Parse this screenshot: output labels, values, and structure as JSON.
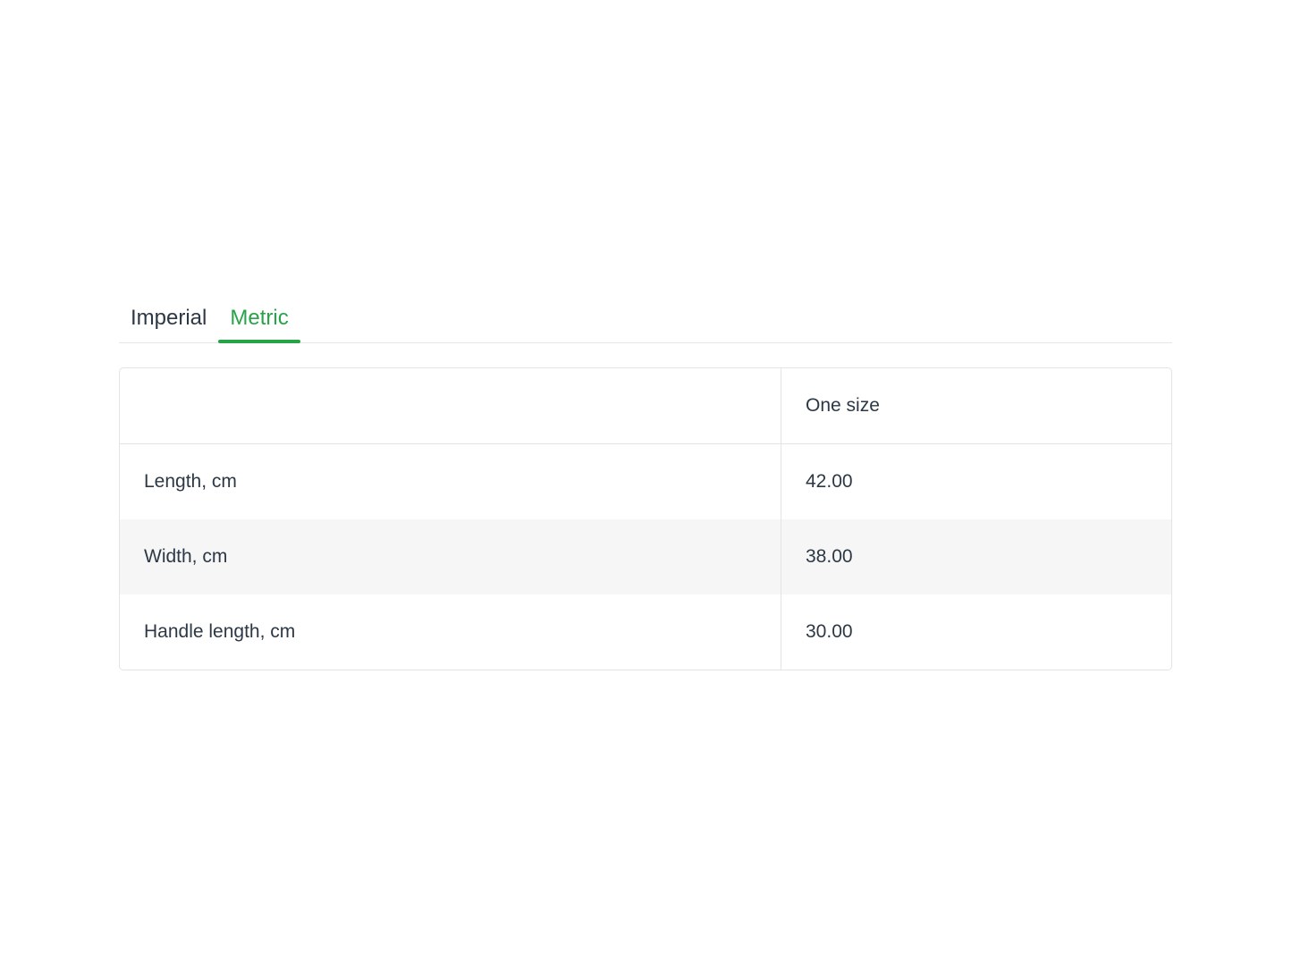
{
  "tabs": [
    {
      "label": "Imperial",
      "active": false
    },
    {
      "label": "Metric",
      "active": true
    }
  ],
  "table": {
    "columns": [
      "",
      "One size"
    ],
    "rows": [
      {
        "label": "Length, cm",
        "value": "42.00"
      },
      {
        "label": "Width, cm",
        "value": "38.00"
      },
      {
        "label": "Handle length, cm",
        "value": "30.00"
      }
    ]
  },
  "colors": {
    "accent_green": "#27a348",
    "text_dark": "#2c3845",
    "border_light": "#e2e5e8",
    "row_stripe": "#f6f6f7"
  }
}
